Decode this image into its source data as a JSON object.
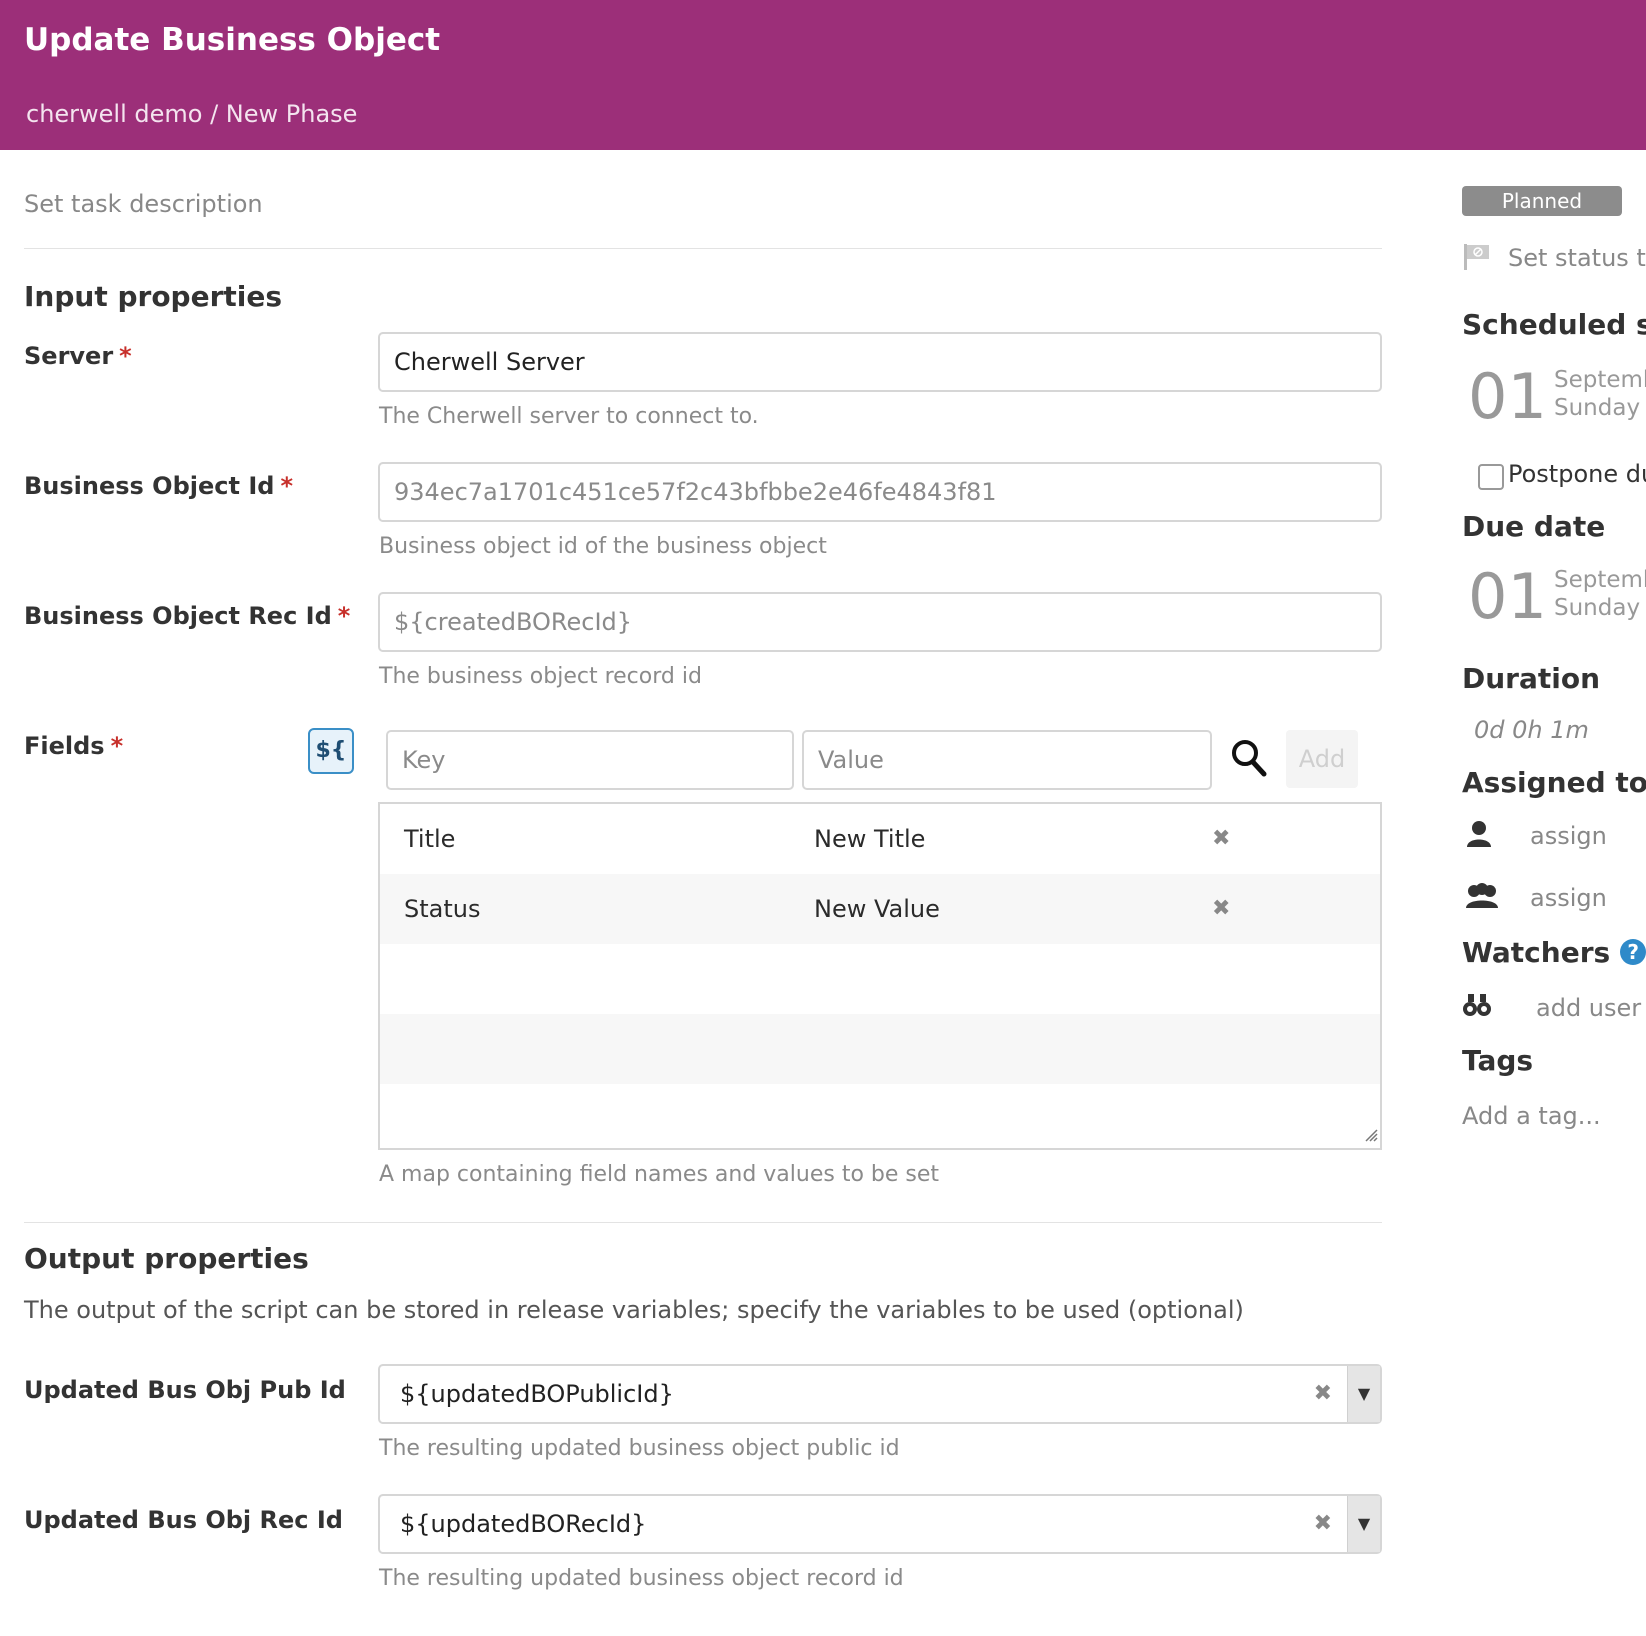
{
  "header": {
    "title": "Update Business Object",
    "breadcrumb": "cherwell demo / New Phase"
  },
  "task": {
    "description_placeholder": "Set task description"
  },
  "input_properties": {
    "title": "Input properties",
    "server": {
      "label": "Server",
      "required_mark": "*",
      "value": "Cherwell Server",
      "help": "The Cherwell server to connect to."
    },
    "business_object_id": {
      "label": "Business Object Id",
      "required_mark": "*",
      "value": "934ec7a1701c451ce57f2c43bfbbe2e46fe4843f81",
      "help": "Business object id of the business object"
    },
    "business_object_rec_id": {
      "label": "Business Object Rec Id",
      "required_mark": "*",
      "value": "${createdBORecId}",
      "help": "The business object record id"
    },
    "fields": {
      "label": "Fields",
      "required_mark": "*",
      "expr_button": "${",
      "key_placeholder": "Key",
      "value_placeholder": "Value",
      "add_label": "Add",
      "rows": [
        {
          "key": "Title",
          "value": "New Title",
          "remove": "✖"
        },
        {
          "key": "Status",
          "value": "New Value",
          "remove": "✖"
        }
      ],
      "help": "A map containing field names and values to be set"
    }
  },
  "output_properties": {
    "title": "Output properties",
    "description": "The output of the script can be stored in release variables; specify the variables to be used (optional)",
    "pub_id": {
      "label": "Updated Bus Obj Pub Id",
      "value": "${updatedBOPublicId}",
      "clear": "✖",
      "arrow": "▼",
      "help": "The resulting updated business object public id"
    },
    "rec_id": {
      "label": "Updated Bus Obj Rec Id",
      "value": "${updatedBORecId}",
      "clear": "✖",
      "arrow": "▼",
      "help": "The resulting updated business object record id"
    }
  },
  "sidebar": {
    "status_badge": "Planned",
    "status_text": "Set status te",
    "scheduled_title": "Scheduled sta",
    "scheduled_day": "01",
    "scheduled_month": "Septemb",
    "scheduled_weekday": "Sunday",
    "postpone_label": "Postpone du",
    "due_title": "Due date",
    "due_day": "01",
    "due_month": "Septemb",
    "due_weekday": "Sunday",
    "duration_title": "Duration",
    "duration_value": "0d 0h 1m",
    "assigned_title": "Assigned to",
    "assign_user": "assign",
    "assign_team": "assign",
    "watchers_title": "Watchers",
    "watchers_help": "?",
    "add_user": "add user",
    "tags_title": "Tags",
    "tags_placeholder": "Add a tag..."
  }
}
